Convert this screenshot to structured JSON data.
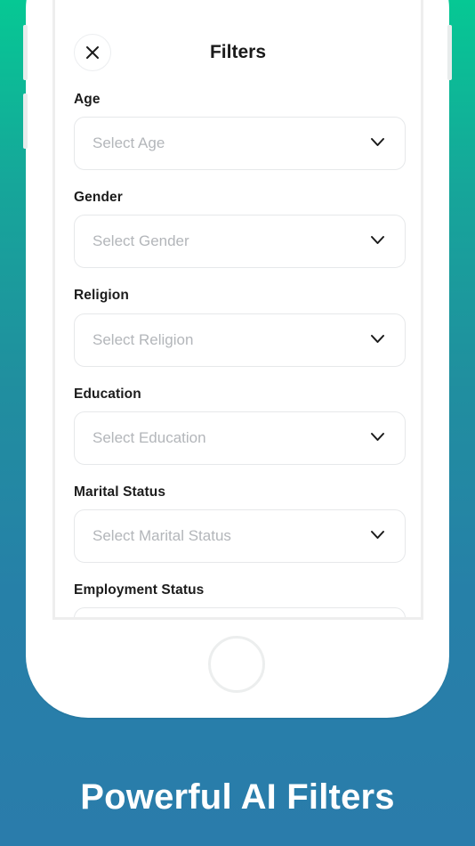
{
  "screen": {
    "title": "Filters",
    "close_icon": "close-icon",
    "fields": [
      {
        "label": "Age",
        "placeholder": "Select Age"
      },
      {
        "label": "Gender",
        "placeholder": "Select Gender"
      },
      {
        "label": "Religion",
        "placeholder": "Select Religion"
      },
      {
        "label": "Education",
        "placeholder": "Select Education"
      },
      {
        "label": "Marital Status",
        "placeholder": "Select Marital Status"
      },
      {
        "label": "Employment Status",
        "placeholder": ""
      }
    ],
    "chevron_icon": "chevron-down-icon"
  },
  "promo": {
    "caption": "Powerful AI Filters"
  },
  "colors": {
    "gradient_top": "#06c894",
    "gradient_bottom": "#2a7cab",
    "placeholder_text": "#b3b6ba",
    "label_text": "#1c1c1c"
  }
}
